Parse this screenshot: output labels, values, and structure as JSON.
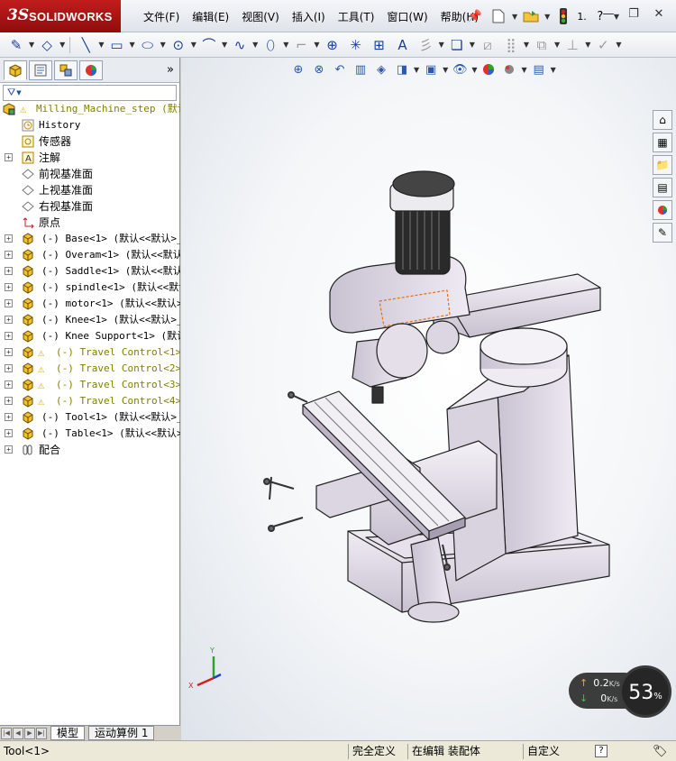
{
  "app": {
    "logo_ds": "3S",
    "logo_name": "SOLIDWORKS"
  },
  "menu": {
    "items": [
      "文件(F)",
      "编辑(E)",
      "视图(V)",
      "插入(I)",
      "工具(T)",
      "窗口(W)",
      "帮助(H)"
    ],
    "rebuild_label": "1."
  },
  "panel": {
    "tabs_icons": [
      "feature-manager-icon",
      "property-manager-icon",
      "configuration-manager-icon",
      "display-manager-icon"
    ],
    "more": "»",
    "filter_symbol": "▼"
  },
  "tree": {
    "root": "Milling_Machine_step  (默认",
    "items": [
      {
        "label": "History",
        "icon": "history-icon"
      },
      {
        "label": "传感器",
        "icon": "sensor-icon"
      },
      {
        "label": "注解",
        "icon": "annotation-icon"
      },
      {
        "label": "前视基准面",
        "icon": "plane-icon"
      },
      {
        "label": "上视基准面",
        "icon": "plane-icon"
      },
      {
        "label": "右视基准面",
        "icon": "plane-icon"
      },
      {
        "label": "原点",
        "icon": "origin-icon"
      }
    ],
    "parts": [
      {
        "label": "(-) Base<1> (默认<<默认>_显",
        "warn": false
      },
      {
        "label": "(-) Overam<1> (默认<<默认>_",
        "warn": false
      },
      {
        "label": "(-) Saddle<1> (默认<<默认>",
        "warn": false
      },
      {
        "label": "(-) spindle<1> (默认<<默认",
        "warn": false
      },
      {
        "label": "(-) motor<1> (默认<<默认>_",
        "warn": false
      },
      {
        "label": "(-) Knee<1> (默认<<默认>_显",
        "warn": false
      },
      {
        "label": "(-) Knee Support<1> (默认<",
        "warn": false
      },
      {
        "label": "(-) Travel Control<1> (",
        "warn": true
      },
      {
        "label": "(-) Travel Control<2> (",
        "warn": true
      },
      {
        "label": "(-) Travel Control<3> (",
        "warn": true
      },
      {
        "label": "(-) Travel Control<4> (",
        "warn": true
      },
      {
        "label": "(-) Tool<1> (默认<<默认>_显",
        "warn": false
      },
      {
        "label": "(-) Table<1> (默认<<默认>_",
        "warn": false
      }
    ],
    "mates": "配合"
  },
  "bottom_tabs": {
    "model": "模型",
    "motion": "运动算例 1"
  },
  "network": {
    "upload": "0.2",
    "upload_unit": "K/s",
    "download": "0",
    "download_unit": "K/s",
    "percent": "53",
    "percent_sign": "%"
  },
  "triad": {
    "x": "X",
    "y": "Y"
  },
  "status": {
    "selection": "Tool<1>",
    "state": "完全定义",
    "mode": "在编辑 装配体",
    "units": "自定义",
    "help": "?"
  },
  "colors": {
    "title_red": "#b81818",
    "viewport_bg": "#f4f6f8",
    "warning": "#e6a800",
    "olive_text": "#7f7f00"
  }
}
